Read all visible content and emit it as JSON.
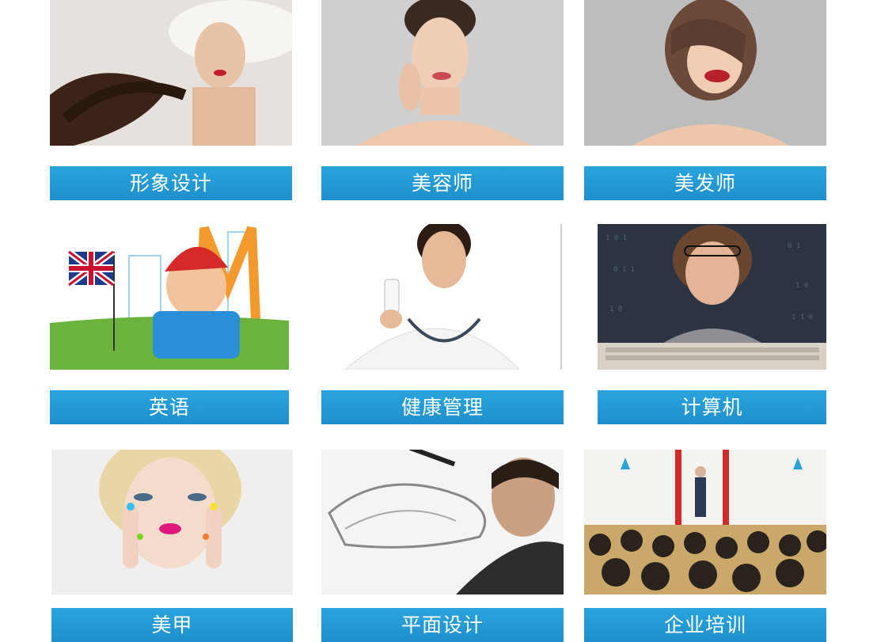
{
  "grid": {
    "items": [
      {
        "label": "形象设计",
        "image": "woman-hat-portrait"
      },
      {
        "label": "美容师",
        "image": "woman-skincare-portrait"
      },
      {
        "label": "美发师",
        "image": "woman-bob-hair-portrait"
      },
      {
        "label": "英语",
        "image": "boy-uk-flag-illustration"
      },
      {
        "label": "健康管理",
        "image": "doctor-holding-bottle"
      },
      {
        "label": "计算机",
        "image": "boy-typing-keyboard"
      },
      {
        "label": "美甲",
        "image": "woman-painted-nails"
      },
      {
        "label": "平面设计",
        "image": "man-sketching-car"
      },
      {
        "label": "企业培训",
        "image": "conference-audience"
      }
    ]
  }
}
